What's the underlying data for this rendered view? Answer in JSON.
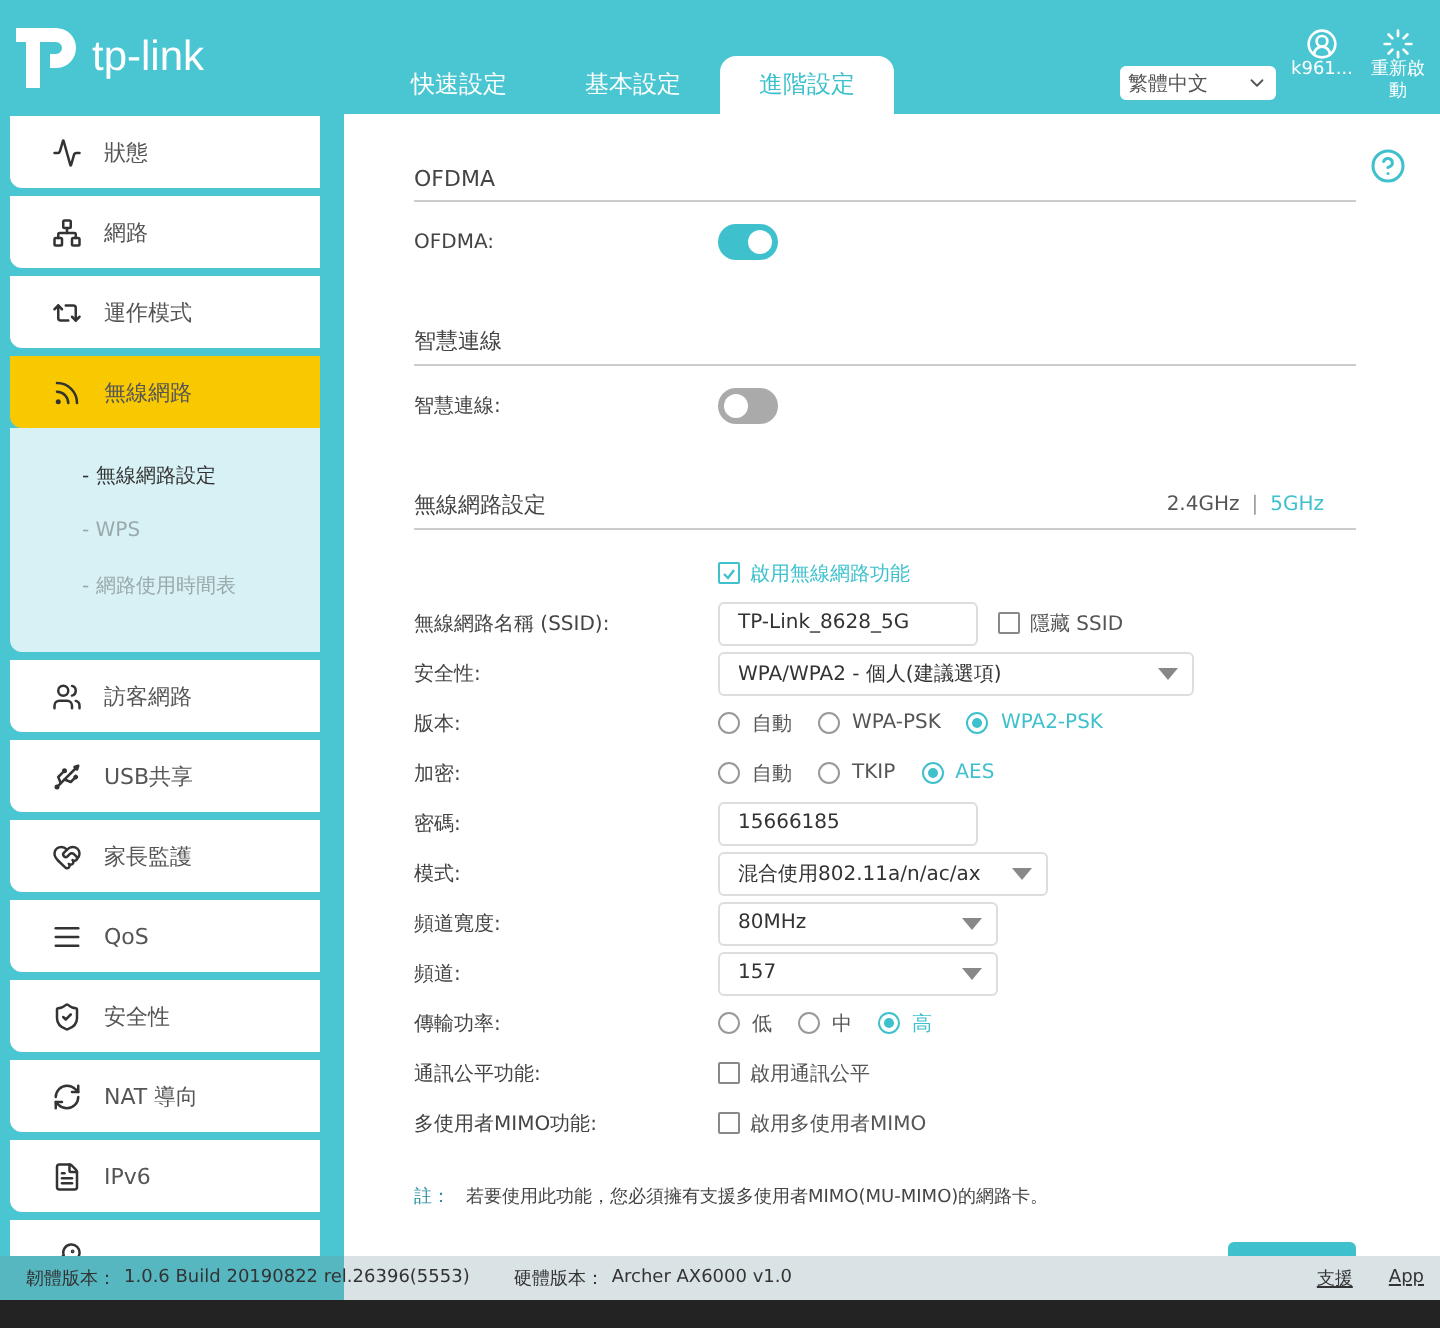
{
  "header": {
    "logo": "tp-link",
    "tabs": [
      {
        "label": "快速設定",
        "selected": false
      },
      {
        "label": "基本設定",
        "selected": false
      },
      {
        "label": "進階設定",
        "selected": true
      }
    ],
    "language": "繁體中文",
    "account": "k961...",
    "reboot": "重新啟動"
  },
  "sidebar": {
    "items": [
      {
        "label": "狀態",
        "selected": false
      },
      {
        "label": "網路",
        "selected": false
      },
      {
        "label": "運作模式",
        "selected": false
      },
      {
        "label": "無線網路",
        "selected": true,
        "children": [
          {
            "label": "- 無線網路設定",
            "selected": true
          },
          {
            "label": "- WPS",
            "selected": false
          },
          {
            "label": "- 網路使用時間表",
            "selected": false
          }
        ]
      },
      {
        "label": "訪客網路",
        "selected": false
      },
      {
        "label": "USB共享",
        "selected": false
      },
      {
        "label": "家長監護",
        "selected": false
      },
      {
        "label": "QoS",
        "selected": false
      },
      {
        "label": "安全性",
        "selected": false
      },
      {
        "label": "NAT 導向",
        "selected": false
      },
      {
        "label": "IPv6",
        "selected": false
      }
    ]
  },
  "sections": [
    {
      "title": "OFDMA",
      "rows": [
        {
          "kind": "toggle",
          "label": "OFDMA:",
          "on": true
        }
      ]
    },
    {
      "title": "智慧連線",
      "rows": [
        {
          "kind": "toggle",
          "label": "智慧連線:",
          "on": false
        }
      ]
    },
    {
      "title": "無線網路設定",
      "bands": [
        {
          "label": "2.4GHz",
          "selected": false
        },
        {
          "label": "5GHz",
          "selected": true
        }
      ],
      "band_separator": "|",
      "rows": [
        {
          "kind": "checkbox",
          "text": "啟用無線網路功能",
          "checked": true
        },
        {
          "kind": "text",
          "label": "無線網路名稱 (SSID):",
          "value": "TP-Link_8628_5G",
          "extra": {
            "text": "隱藏 SSID",
            "checked": false
          }
        },
        {
          "kind": "select",
          "label": "安全性:",
          "value": "WPA/WPA2 - 個人(建議選項)"
        },
        {
          "kind": "radio",
          "label": "版本:",
          "options": [
            {
              "label": "自動",
              "selected": false
            },
            {
              "label": "WPA-PSK",
              "selected": false
            },
            {
              "label": "WPA2-PSK",
              "selected": true
            }
          ]
        },
        {
          "kind": "radio",
          "label": "加密:",
          "options": [
            {
              "label": "自動",
              "selected": false
            },
            {
              "label": "TKIP",
              "selected": false
            },
            {
              "label": "AES",
              "selected": true
            }
          ]
        },
        {
          "kind": "text",
          "label": "密碼:",
          "value": "15666185"
        },
        {
          "kind": "select",
          "label": "模式:",
          "value": "混合使用802.11a/n/ac/ax"
        },
        {
          "kind": "select",
          "label": "頻道寬度:",
          "value": "80MHz"
        },
        {
          "kind": "select",
          "label": "頻道:",
          "value": "157"
        },
        {
          "kind": "radio",
          "label": "傳輸功率:",
          "options": [
            {
              "label": "低",
              "selected": false
            },
            {
              "label": "中",
              "selected": false
            },
            {
              "label": "高",
              "selected": true
            }
          ]
        },
        {
          "kind": "checkbox",
          "label": "通訊公平功能:",
          "text": "啟用通訊公平",
          "checked": false
        },
        {
          "kind": "checkbox",
          "label": "多使用者MIMO功能:",
          "text": "啟用多使用者MIMO",
          "checked": false
        }
      ]
    }
  ],
  "note": {
    "label": "註：",
    "text": "若要使用此功能，您必須擁有支援多使用者MIMO(MU-MIMO)的網路卡。"
  },
  "footer": {
    "firmware_label": "韌體版本：",
    "firmware": "1.0.6 Build 20190822 rel.26396(5553)",
    "hardware_label": "硬體版本：",
    "hardware": "Archer AX6000 v1.0",
    "links": [
      "支援",
      "App"
    ]
  }
}
